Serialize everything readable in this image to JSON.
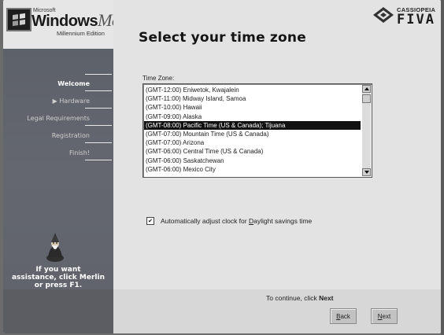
{
  "branding": {
    "ms_small": "Microsoft",
    "windows_word": "Windows",
    "me_word": "Me",
    "edition": "Millennium Edition",
    "brand_top": "CASSIOPEIA",
    "brand_main": "FIVA"
  },
  "page": {
    "title": "Select your time zone"
  },
  "sidebar": {
    "items": [
      {
        "label": "Welcome",
        "active": true
      },
      {
        "label": "Hardware",
        "active": false,
        "prefix": "▶ "
      },
      {
        "label": "Legal Requirements",
        "active": false
      },
      {
        "label": "Registration",
        "active": false
      },
      {
        "label": "Finish!",
        "active": false
      }
    ],
    "help_line1": "If you want",
    "help_line2": "assistance, click Merlin",
    "help_line3": "or press F1."
  },
  "timezone": {
    "label": "Time Zone:",
    "items": [
      "(GMT-12:00) Eniwetok, Kwajalein",
      "(GMT-11:00) Midway Island, Samoa",
      "(GMT-10:00) Hawaii",
      "(GMT-09:00) Alaska",
      "(GMT-08:00) Pacific Time (US & Canada); Tijuana",
      "(GMT-07:00) Mountain Time (US & Canada)",
      "(GMT-07:00) Arizona",
      "(GMT-06:00) Central Time (US & Canada)",
      "(GMT-06:00) Saskatchewan",
      "(GMT-06:00) Mexico City"
    ],
    "selected_index": 4
  },
  "dst": {
    "checked": true,
    "label_pre": "Automatically adjust clock for ",
    "label_key": "D",
    "label_post": "aylight savings time"
  },
  "footer": {
    "continue_pre": "To continue, click ",
    "continue_bold": "Next",
    "back_key": "B",
    "back_rest": "ack",
    "next_key": "N",
    "next_rest": "ext"
  },
  "icons": {
    "windows_logo": "windows-flag-icon",
    "merlin": "merlin-wizard-icon",
    "brand": "cassiopeia-logo-icon"
  }
}
